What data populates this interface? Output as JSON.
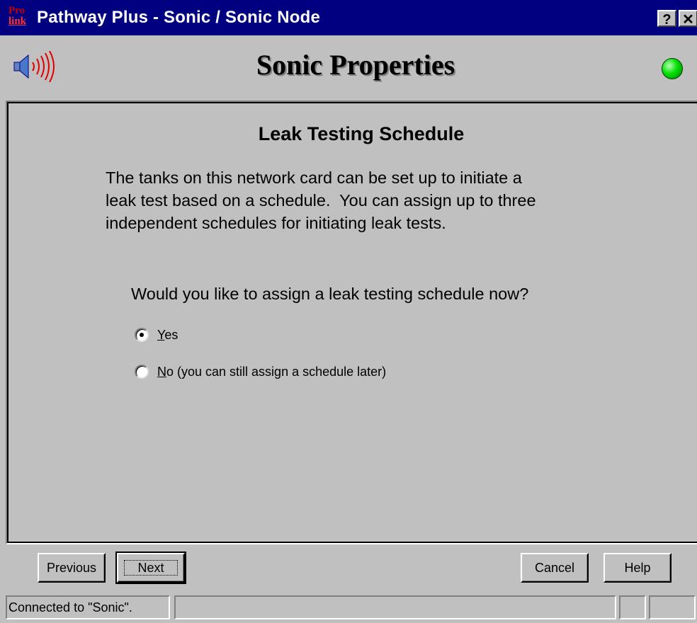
{
  "window": {
    "title": "Pathway Plus - Sonic / Sonic Node",
    "icon_text_top": "Pro",
    "icon_text_bottom": "link",
    "help_button": "?",
    "close_button": "✕"
  },
  "header": {
    "title": "Sonic Properties",
    "left_icon": "speaker-sound-icon",
    "status_led_color": "#00e000"
  },
  "content": {
    "heading": "Leak Testing Schedule",
    "description_lines": [
      "The tanks on this network card can be set up to initiate a",
      "leak test based on a schedule.  You can assign up to three",
      "independent schedules for initiating leak tests."
    ],
    "question": "Would you like to assign a leak testing schedule now?",
    "options": [
      {
        "mnemonic": "Y",
        "rest": "es",
        "selected": true
      },
      {
        "mnemonic": "N",
        "rest": "o (you can still assign a schedule later)",
        "selected": false
      }
    ]
  },
  "buttons": {
    "previous": "Previous",
    "next": "Next",
    "cancel": "Cancel",
    "help": "Help"
  },
  "statusbar": {
    "text": "Connected to \"Sonic\"."
  }
}
